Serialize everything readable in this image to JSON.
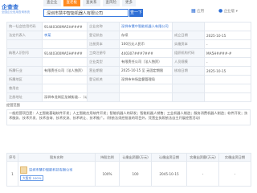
{
  "brand": {
    "name": "企查查",
    "tagline": "全国企业信用查询系统"
  },
  "nav": [
    "查企业",
    "查老板",
    "查关系",
    "查风险",
    "更多"
  ],
  "search": {
    "value": "深圳市慧中智能机器人有限公司",
    "button": "查一下"
  },
  "header_right": {
    "app": "应用",
    "user": "企业版"
  },
  "info_rows": [
    [
      "统一社会信用代码",
      "91440300MA5H####",
      "企业名称",
      "深圳市慧中智能机器人有限公司",
      "",
      ""
    ],
    [
      "法定代表人",
      "李某",
      "登记状态",
      "存续",
      "成立日期",
      "2025-10-15"
    ],
    [
      "",
      "",
      "注册资本",
      "100万元人民币",
      "实缴资本",
      "-"
    ],
    [
      "纳税人识别号",
      "91440300MA5H####",
      "工商注册号",
      "440307###7###",
      "组织机构代码",
      "MA5H####-#"
    ],
    [
      "",
      "",
      "企业类型",
      "有限责任公司（法人独资）",
      "人员规模",
      "-"
    ],
    [
      "所属行业",
      "有限责任公司（法人独资）",
      "营业期限",
      "2025-10-15 至 无固定期限",
      "核准日期",
      "2025-10-15"
    ],
    [
      "所属地区",
      "",
      "登记机关",
      "深圳市市场监督管理局",
      "",
      ""
    ],
    [
      "曾用名",
      "",
      "",
      "",
      "",
      ""
    ],
    [
      "注册地址",
      "深圳市龙岗区龙城街道…（以上地址为企业登记地址）",
      "",
      "",
      "",
      ""
    ]
  ],
  "scope_label": "经营范围",
  "scope_text": "一般经营项目是：人工智能基础软件开发；人工智能应用软件开发；智能机器人的研发；智能机器人销售；工业机器人制造；服务消费机器人制造；软件开发；技术服务、技术开发、技术咨询、技术交流、技术转让、技术推广。（除依法须经批准的项目外，凭营业执照依法自主开展经营活动）",
  "investor_headers": [
    "序号",
    "股东名称",
    "持股比例",
    "认缴出资额(万元)",
    "认缴出资日期",
    "实缴出资额(万元)",
    "实缴出资日期"
  ],
  "investors": [
    {
      "index": "1",
      "name": "深圳市慧中智能科技有限公司",
      "tag": "大股东 100%",
      "ratio": "100%",
      "sub_amount": "100",
      "sub_date": "2045-10-15",
      "paid_amount": "-",
      "paid_date": "-"
    }
  ]
}
